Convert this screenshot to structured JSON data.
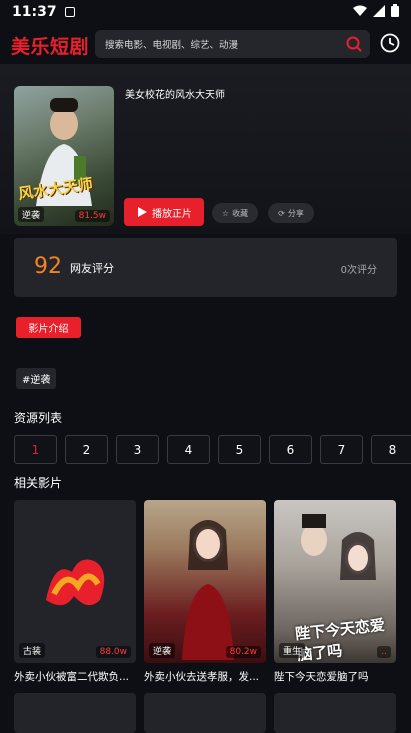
{
  "status_bar": {
    "time": "11:37"
  },
  "header": {
    "logo": "美乐短剧",
    "search_placeholder": "搜索电影、电视剧、综艺、动漫",
    "icons": [
      "search-icon",
      "history-icon"
    ]
  },
  "drama": {
    "title": "美女校花的风水大天师",
    "poster_title": "风水大天师",
    "poster_tag": "逆袭",
    "poster_count": "81.5w",
    "play_label": "播放正片",
    "favorite_label": "收藏",
    "share_label": "分享",
    "rating_score": "92",
    "rating_label": "网友评分",
    "rating_count": "0次评分",
    "intro_label": "影片介绍",
    "tag": "#逆袭"
  },
  "episodes": {
    "section_title": "资源列表",
    "items": [
      "1",
      "2",
      "3",
      "4",
      "5",
      "6",
      "7",
      "8"
    ],
    "active": "1"
  },
  "related": {
    "section_title": "相关影片",
    "items": [
      {
        "title": "外卖小伙被富二代欺负...",
        "tag": "古装",
        "count": "88.0w"
      },
      {
        "title": "外卖小伙去送孝服，发...",
        "tag": "逆袭",
        "count": "80.2w"
      },
      {
        "title": "陛下今天恋爱脑了吗",
        "tag": "重生",
        "count": "..",
        "art_text": "陛下今天恋爱脑了吗"
      }
    ]
  },
  "colors": {
    "accent": "#e8202b",
    "score": "#f5831f",
    "background": "#0e0f14",
    "panel": "#24252b"
  }
}
